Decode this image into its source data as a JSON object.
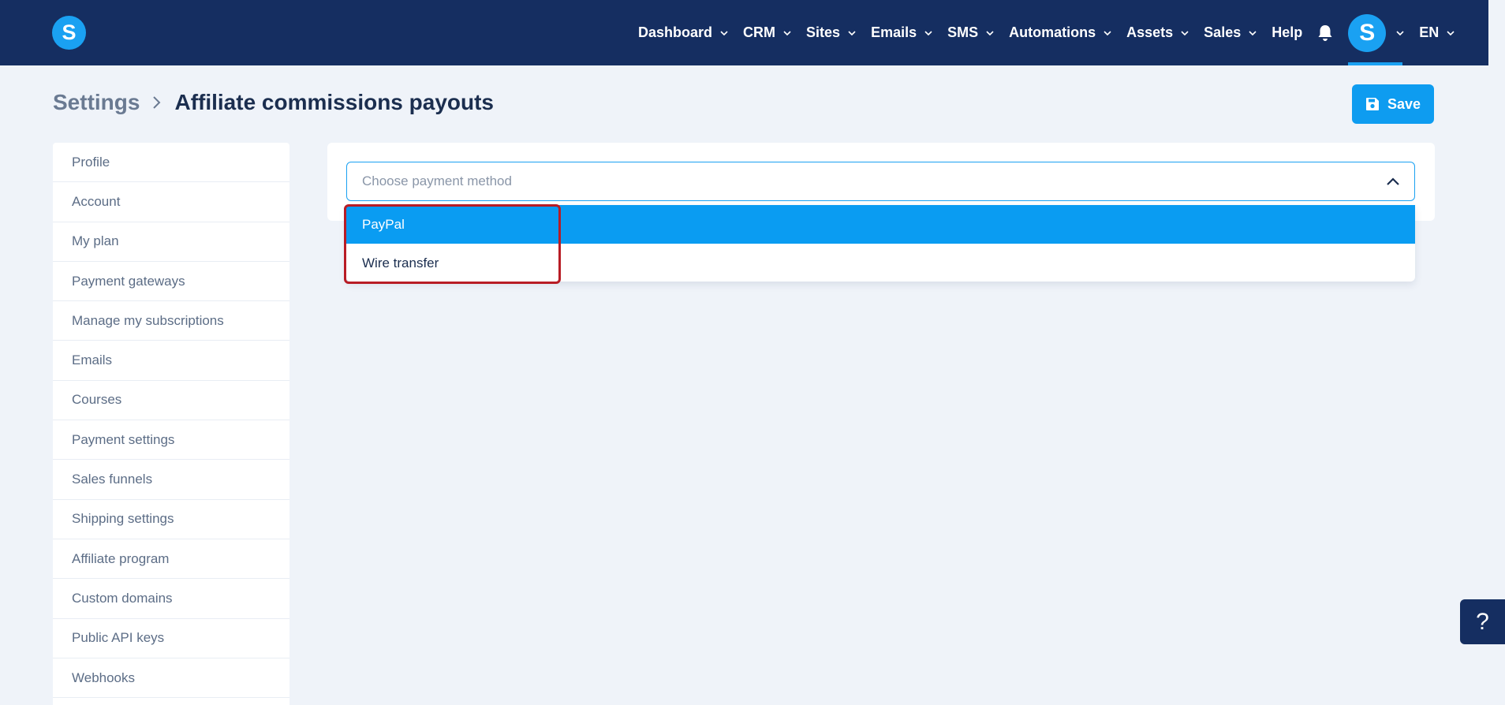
{
  "brand": {
    "logo_letter": "S",
    "accent_color": "#1aa1f2",
    "nav_bg": "#152e61"
  },
  "nav": {
    "items": [
      {
        "label": "Dashboard",
        "has_dropdown": true
      },
      {
        "label": "CRM",
        "has_dropdown": true
      },
      {
        "label": "Sites",
        "has_dropdown": true
      },
      {
        "label": "Emails",
        "has_dropdown": true
      },
      {
        "label": "SMS",
        "has_dropdown": true
      },
      {
        "label": "Automations",
        "has_dropdown": true
      },
      {
        "label": "Assets",
        "has_dropdown": true
      },
      {
        "label": "Sales",
        "has_dropdown": true
      },
      {
        "label": "Help",
        "has_dropdown": false
      }
    ],
    "notification_icon": "bell-icon",
    "avatar_letter": "S",
    "language": "EN"
  },
  "header": {
    "breadcrumb_root": "Settings",
    "page_title": "Affiliate commissions payouts",
    "save_label": "Save"
  },
  "sidebar": {
    "items": [
      {
        "label": "Profile"
      },
      {
        "label": "Account"
      },
      {
        "label": "My plan"
      },
      {
        "label": "Payment gateways"
      },
      {
        "label": "Manage my subscriptions"
      },
      {
        "label": "Emails"
      },
      {
        "label": "Courses"
      },
      {
        "label": "Payment settings"
      },
      {
        "label": "Sales funnels"
      },
      {
        "label": "Shipping settings"
      },
      {
        "label": "Affiliate program"
      },
      {
        "label": "Custom domains"
      },
      {
        "label": "Public API keys"
      },
      {
        "label": "Webhooks"
      }
    ]
  },
  "payment_method": {
    "placeholder": "Choose payment method",
    "options": [
      {
        "label": "PayPal",
        "highlighted": true
      },
      {
        "label": "Wire transfer",
        "highlighted": false
      }
    ]
  },
  "help_button": {
    "label": "?"
  }
}
